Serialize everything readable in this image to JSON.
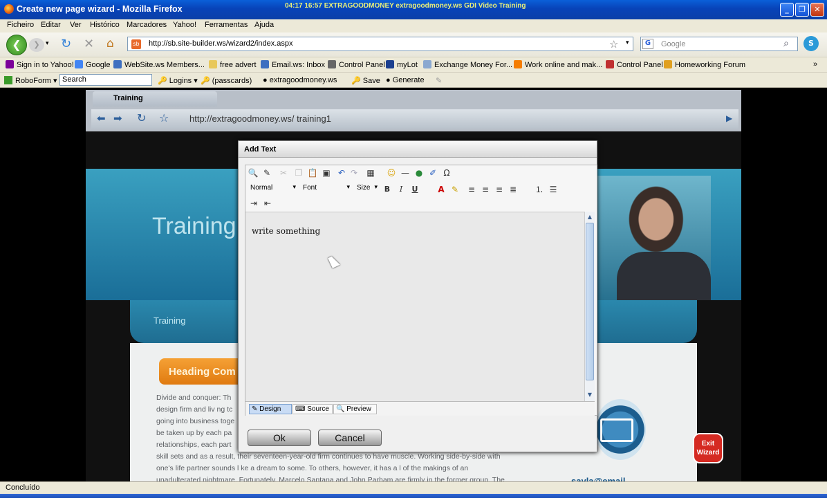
{
  "window": {
    "title": "Create new page wizard - Mozilla Firefox",
    "recording_overlay": "04:17  16:57  EXTRAGOODMONEY  extragoodmoney.ws  GDI Video Training"
  },
  "menu": [
    "Ficheiro",
    "Editar",
    "Ver",
    "Histórico",
    "Marcadores",
    "Yahoo!",
    "Ferramentas",
    "Ajuda"
  ],
  "nav": {
    "url": "http://sb.site-builder.ws/wizard2/index.aspx",
    "search_placeholder": "Google"
  },
  "bookmarks": [
    "Sign in to Yahoo!",
    "Google",
    "WebSite.ws Members...",
    "free advert",
    "Email.ws: Inbox",
    "Control Panel",
    "myLot",
    "Exchange Money For...",
    "Work online and mak...",
    "Control Panel",
    "Homeworking Forum"
  ],
  "roboform": {
    "label": "RoboForm",
    "search_value": "Search",
    "items": [
      "Logins",
      "(passcards)",
      "extragoodmoney.ws",
      "Save",
      "Generate"
    ]
  },
  "preview": {
    "tab_title": "Training",
    "url": "http://extragoodmoney.ws/ training1",
    "banner_heading": "Training",
    "nav_item": "Training",
    "content_heading": "Heading Com",
    "paragraph": [
      "Divide and conquer: Th",
      "design firm and  liv ng tc",
      "going into business toge",
      "be taken up by each pa",
      "relationships, each part",
      "skill sets and as a  result, their seventeen-year-old firm continues to have muscle. Working side-by-side with",
      "one's life partner sounds l ke a dream to some. To others, however, it has a l of the makings of an",
      "unadulterated nightmare. Fortunately, Marcelo Santana and John Parham are firmly in the former group. The"
    ],
    "email": "sayla@email",
    "exit_label": "Exit Wizard"
  },
  "dialog": {
    "title": "Add Text",
    "format_select": "Normal",
    "font_select": "Font",
    "size_select": "Size",
    "editor_text": "write something",
    "tabs": [
      "Design",
      "Source",
      "Preview"
    ],
    "ok": "Ok",
    "cancel": "Cancel"
  },
  "status": "Concluído"
}
